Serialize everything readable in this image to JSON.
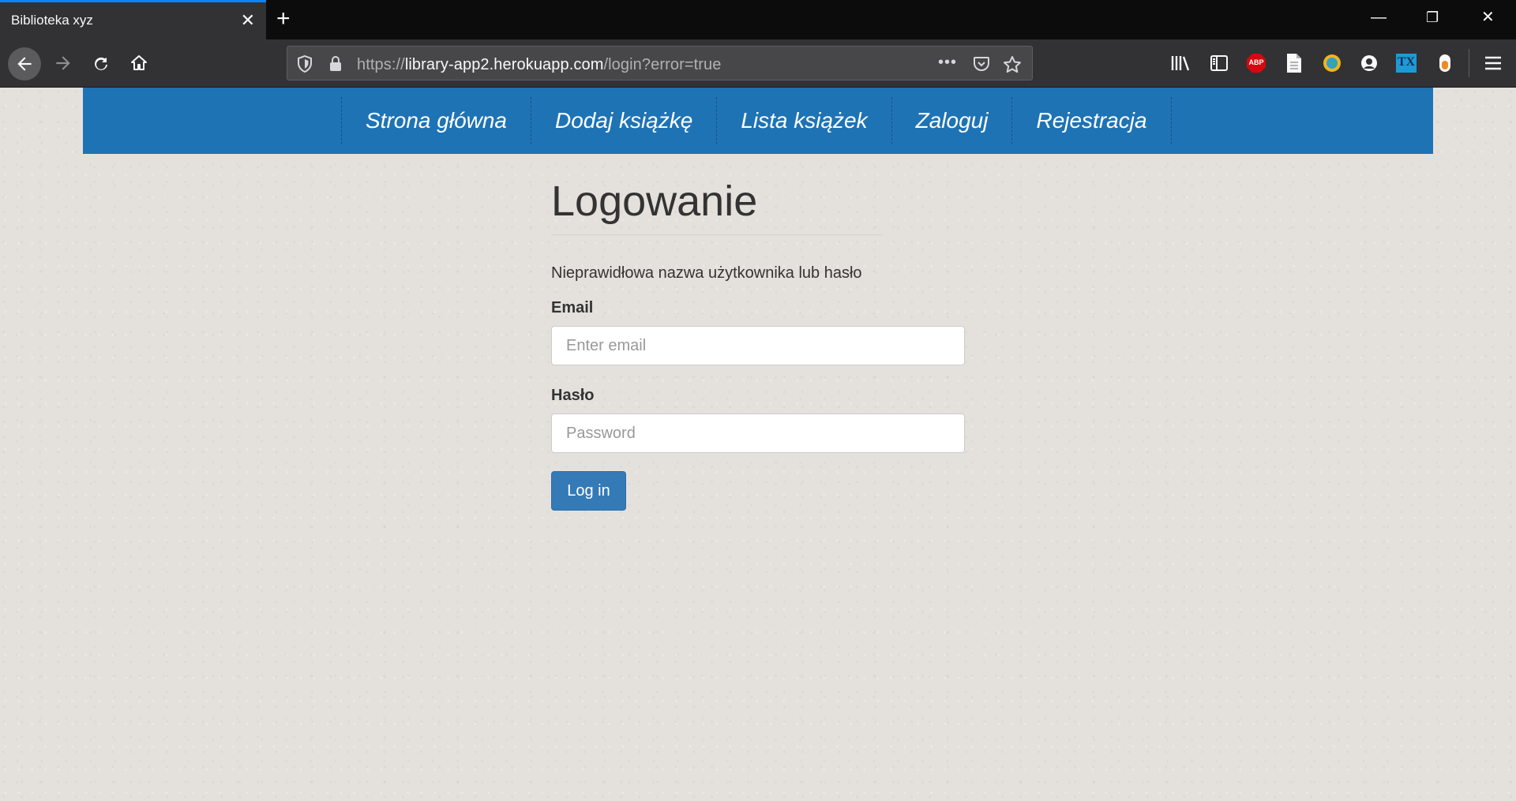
{
  "browser": {
    "tab_title": "Biblioteka xyz",
    "tab_close": "✕",
    "new_tab": "+",
    "url_prefix": "https://",
    "url_host": "library-app2.herokuapp.com",
    "url_path": "/login?error=true",
    "page_actions": "•••",
    "window_controls": {
      "minimize": "—",
      "restore": "❐",
      "close": "✕"
    },
    "extension_abp_label": "ABP",
    "extension_tx_label": "TX",
    "colors": {
      "tab_accent": "#0a84ff",
      "chrome_dark": "#0c0c0d",
      "toolbar": "#323234"
    }
  },
  "site_nav": {
    "items": [
      {
        "label": "Strona główna"
      },
      {
        "label": "Dodaj książkę"
      },
      {
        "label": "Lista książek"
      },
      {
        "label": "Zaloguj"
      },
      {
        "label": "Rejestracja"
      }
    ],
    "color": "#1e73b5"
  },
  "login": {
    "heading": "Logowanie",
    "error_message": "Nieprawidłowa nazwa użytkownika lub hasło",
    "email_label": "Email",
    "email_placeholder": "Enter email",
    "password_label": "Hasło",
    "password_placeholder": "Password",
    "submit_label": "Log in",
    "button_color": "#337ab7"
  }
}
